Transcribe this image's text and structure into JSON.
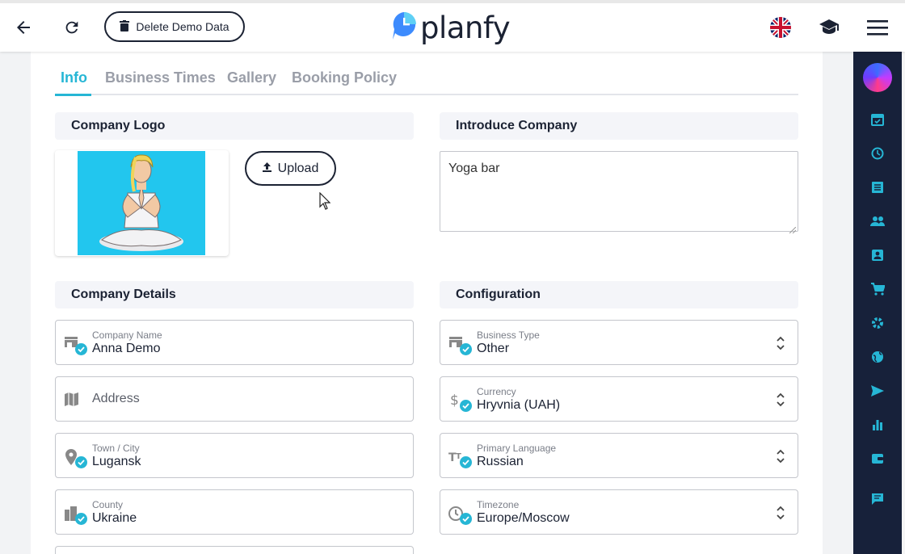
{
  "header": {
    "demo_button_label": "Delete Demo Data",
    "brand": "planfy",
    "icons": [
      "back-arrow-icon",
      "refresh-icon",
      "trash-icon",
      "uk-flag-icon",
      "graduation-cap-icon",
      "hamburger-menu-icon"
    ]
  },
  "tabs": [
    {
      "label": "Info",
      "active": true
    },
    {
      "label": "Business Times",
      "active": false
    },
    {
      "label": "Gallery",
      "active": false
    },
    {
      "label": "Booking Policy",
      "active": false
    }
  ],
  "sections": {
    "company_logo": "Company Logo",
    "introduce_company": "Introduce Company",
    "company_details": "Company Details",
    "configuration": "Configuration"
  },
  "upload_label": "Upload",
  "intro_text": "Yoga bar",
  "company_details": {
    "name": {
      "label": "Company Name",
      "value": "Anna Demo"
    },
    "address": {
      "placeholder": "Address"
    },
    "town": {
      "label": "Town / City",
      "value": "Lugansk"
    },
    "county": {
      "label": "County",
      "value": "Ukraine"
    }
  },
  "configuration": {
    "business_type": {
      "label": "Business Type",
      "value": "Other"
    },
    "currency": {
      "label": "Currency",
      "value": "Hryvnia (UAH)"
    },
    "language": {
      "label": "Primary Language",
      "value": "Russian"
    },
    "timezone": {
      "label": "Timezone",
      "value": "Europe/Moscow"
    }
  },
  "sidebar": {
    "items": [
      "calendar-check-icon",
      "clock-icon",
      "list-icon",
      "people-icon",
      "contact-card-icon",
      "cart-icon",
      "gear-icon",
      "globe-icon",
      "send-icon",
      "bar-chart-icon",
      "wallet-icon",
      "chat-icon"
    ]
  },
  "colors": {
    "accent": "#26b6d5",
    "sidebar": "#17213a",
    "dark": "#1b2233"
  }
}
